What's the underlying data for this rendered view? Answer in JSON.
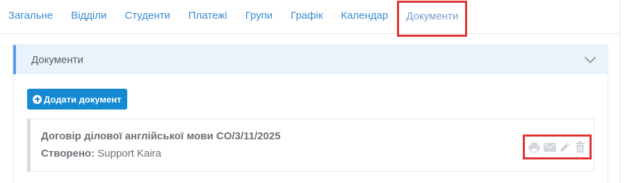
{
  "tabs": [
    {
      "label": "Загальне",
      "active": false
    },
    {
      "label": "Відділи",
      "active": false
    },
    {
      "label": "Студенти",
      "active": false
    },
    {
      "label": "Платежі",
      "active": false
    },
    {
      "label": "Групи",
      "active": false
    },
    {
      "label": "Графік",
      "active": false
    },
    {
      "label": "Календар",
      "active": false
    },
    {
      "label": "Документи",
      "active": true
    }
  ],
  "panel": {
    "title": "Документи",
    "collapse_icon": "chevron-down-icon",
    "add_button_label": "Додати документ",
    "add_button_icon": "plus-circle-icon"
  },
  "documents": [
    {
      "title": "Договір ділової англійської мови CO/3/11/2025",
      "created_label": "Створено:",
      "created_by": "Support Kaira",
      "actions": [
        "print-icon",
        "envelope-icon",
        "pencil-icon",
        "trash-icon"
      ]
    }
  ],
  "colors": {
    "tab_link": "#3a8bd3",
    "tab_active": "#7a9cd2",
    "highlight_box": "#e03232",
    "panel_header_bg": "#e9f3fc",
    "panel_accent": "#5b9ae6",
    "button_bg": "#1589d1",
    "action_icons": "#d2d5d9"
  }
}
